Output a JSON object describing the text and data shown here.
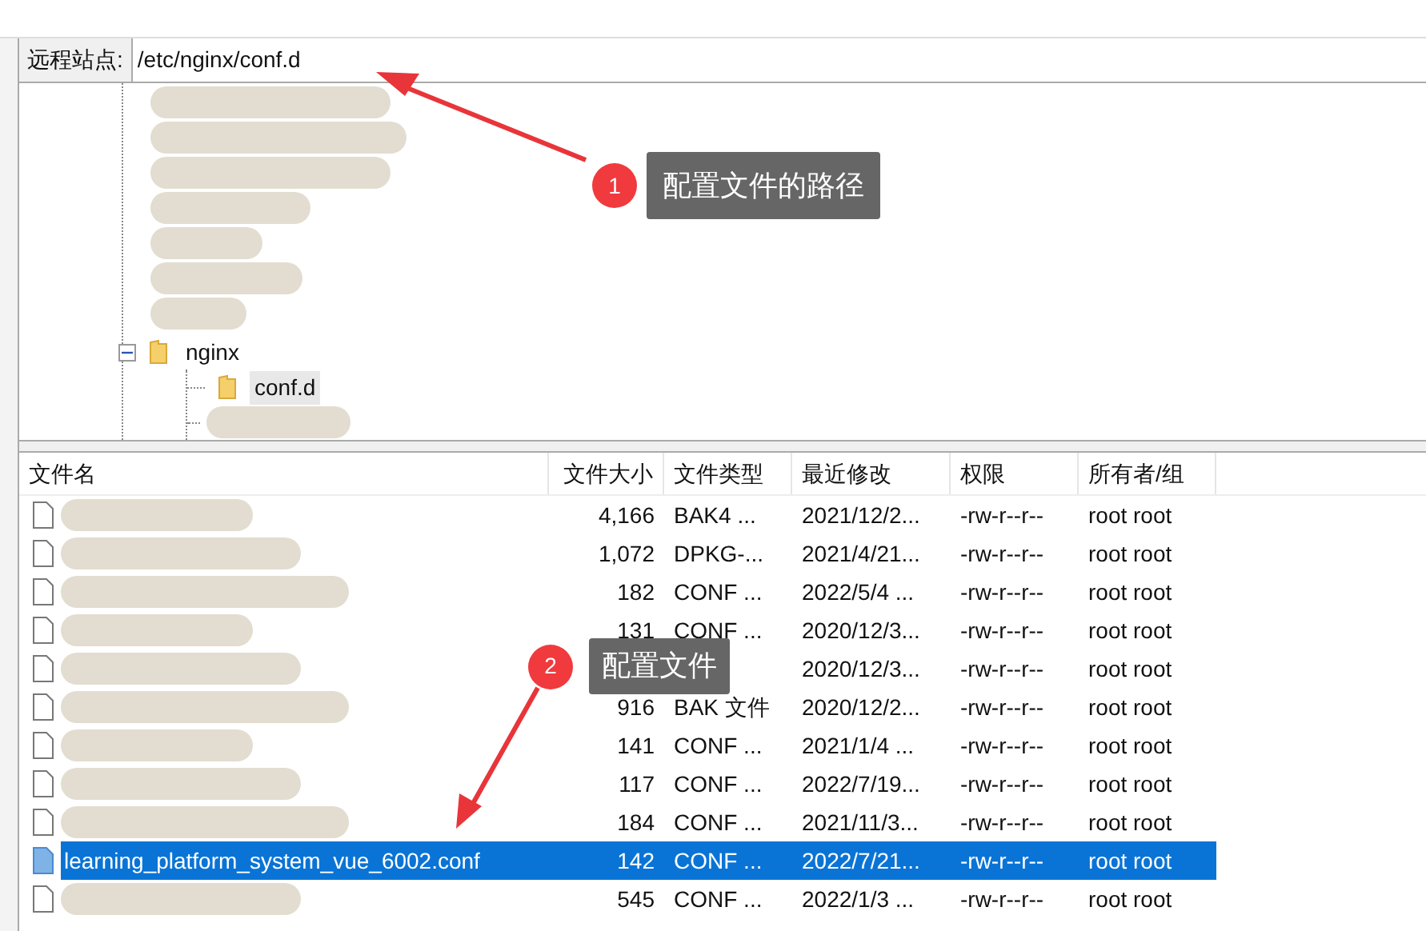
{
  "address_bar": {
    "label": "远程站点:",
    "path": "/etc/nginx/conf.d"
  },
  "tree": [
    {
      "label": "nginx",
      "selected": false,
      "expanded": true,
      "children": [
        {
          "label": "conf.d",
          "selected": true
        }
      ]
    }
  ],
  "file_list": {
    "columns": [
      "文件名",
      "文件大小",
      "文件类型",
      "最近修改",
      "权限",
      "所有者/组"
    ],
    "rows": [
      {
        "selected": false,
        "size": "4,166",
        "type": "BAK4 ...",
        "modified": "2021/12/2...",
        "permissions": "-rw-r--r--",
        "owner": "root root"
      },
      {
        "selected": false,
        "size": "1,072",
        "type": "DPKG-...",
        "modified": "2021/4/21...",
        "permissions": "-rw-r--r--",
        "owner": "root root"
      },
      {
        "selected": false,
        "size": "182",
        "type": "CONF ...",
        "modified": "2022/5/4 ...",
        "permissions": "-rw-r--r--",
        "owner": "root root"
      },
      {
        "selected": false,
        "size": "131",
        "type": "CONF ...",
        "modified": "2020/12/3...",
        "permissions": "-rw-r--r--",
        "owner": "root root"
      },
      {
        "selected": false,
        "modified": "2020/12/3...",
        "permissions": "-rw-r--r--",
        "owner": "root root"
      },
      {
        "selected": false,
        "size": "916",
        "type": "BAK 文件",
        "modified": "2020/12/2...",
        "permissions": "-rw-r--r--",
        "owner": "root root"
      },
      {
        "selected": false,
        "size": "141",
        "type": "CONF ...",
        "modified": "2021/1/4 ...",
        "permissions": "-rw-r--r--",
        "owner": "root root"
      },
      {
        "selected": false,
        "size": "117",
        "type": "CONF ...",
        "modified": "2022/7/19...",
        "permissions": "-rw-r--r--",
        "owner": "root root"
      },
      {
        "selected": false,
        "size": "184",
        "type": "CONF ...",
        "modified": "2021/11/3...",
        "permissions": "-rw-r--r--",
        "owner": "root root"
      },
      {
        "selected": true,
        "name": "learning_platform_system_vue_6002.conf",
        "size": "142",
        "type": "CONF ...",
        "modified": "2022/7/21...",
        "permissions": "-rw-r--r--",
        "owner": "root root"
      },
      {
        "selected": false,
        "size": "545",
        "type": "CONF ...",
        "modified": "2022/1/3 ...",
        "permissions": "-rw-r--r--",
        "owner": "root root"
      }
    ]
  },
  "annotations": [
    {
      "number": "1",
      "text": "配置文件的路径"
    },
    {
      "number": "2",
      "text": "配置文件"
    }
  ]
}
